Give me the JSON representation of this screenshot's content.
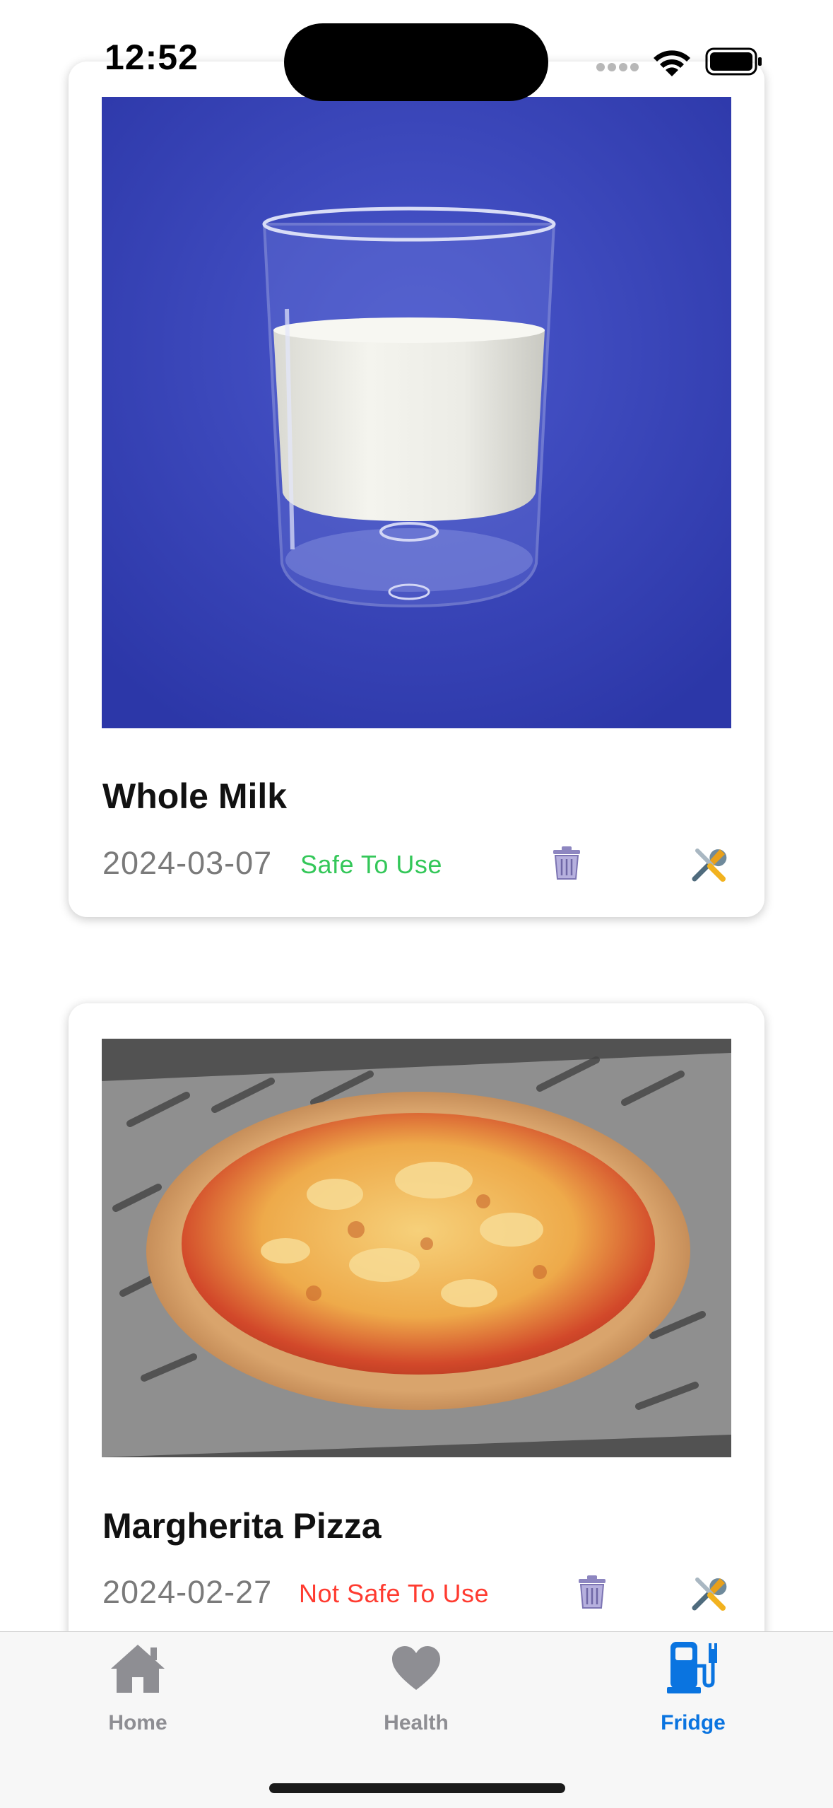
{
  "status_bar": {
    "time": "12:52"
  },
  "items": [
    {
      "name": "Whole Milk",
      "date": "2024-03-07",
      "status": "Safe To Use",
      "status_color": "#34c759"
    },
    {
      "name": "Margherita Pizza",
      "date": "2024-02-27",
      "status": "Not Safe To Use",
      "status_color": "#ff3b30"
    }
  ],
  "tabs": [
    {
      "label": "Home",
      "icon": "house-icon",
      "active": false
    },
    {
      "label": "Health",
      "icon": "heart-icon",
      "active": false
    },
    {
      "label": "Fridge",
      "icon": "fuel-pump-icon",
      "active": true
    }
  ],
  "colors": {
    "accent": "#0a74e0",
    "inactive": "#8e8e93"
  }
}
